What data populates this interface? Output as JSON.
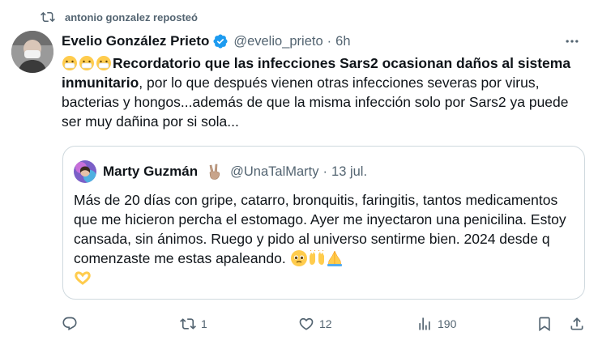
{
  "repost": {
    "text": "antonio gonzalez reposteó"
  },
  "tweet": {
    "author_name": "Evelio González Prieto",
    "handle": "@evelio_prieto",
    "separator": "·",
    "time": "6h",
    "text_bold": "Recordatorio que las infecciones Sars2 ocasionan daños al sistema inmunitario",
    "text_rest": ", por lo que después vienen otras infecciones severas por virus, bacterias y hongos...además de que la misma infección solo por Sars2 ya puede ser muy dañina por si sola...",
    "emoji": "mask-face-emoji x3"
  },
  "quote": {
    "author_name": "Marty Guzmán",
    "handle": "@UnaTalMarty",
    "separator": "·",
    "time": "13 jul.",
    "text": "Más de 20 días con gripe, catarro, bronquitis, faringitis, tantos medicamentos que me hicieron percha el estomago. Ayer me inyectaron una penicilina. Estoy cansada, sin ánimos. Ruego y pido al universo sentirme bien. 2024 desde q comenzaste me estas apaleando."
  },
  "actions": {
    "reply_count": "",
    "repost_count": "1",
    "like_count": "12",
    "views_count": "190"
  },
  "colors": {
    "verified": "#1d9bf0",
    "muted": "#536471",
    "text": "#0f1419",
    "border": "#cfd9de"
  }
}
